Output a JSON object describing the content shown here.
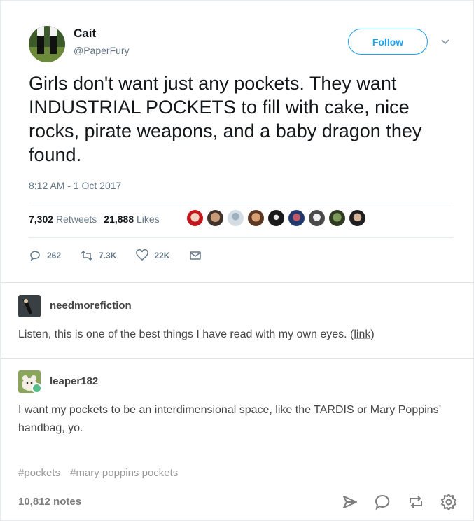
{
  "tweet": {
    "author_name": "Cait",
    "author_handle": "@PaperFury",
    "follow_label": "Follow",
    "text": "Girls don't want just any pockets. They want INDUSTRIAL POCKETS to fill with cake, nice rocks, pirate weapons, and a baby dragon they found.",
    "timestamp": "8:12 AM - 1 Oct 2017",
    "retweets_count": "7,302",
    "retweets_label": "Retweets",
    "likes_count": "21,888",
    "likes_label": "Likes",
    "reply_count": "262",
    "retweet_count_short": "7.3K",
    "like_count_short": "22K",
    "accent_color": "#1da1f2"
  },
  "reblogs": [
    {
      "username": "needmorefiction",
      "text": "Listen, this is one of the best things I have read with my own eyes. (",
      "link_text": "link",
      "text_end": ")"
    },
    {
      "username": "leaper182",
      "text": "I want my pockets to be an interdimensional space, like the TARDIS or Mary Poppins’ handbag, yo."
    }
  ],
  "tags": [
    "#pockets",
    "#mary poppins pockets"
  ],
  "notes": "10,812 notes",
  "icons": [
    "share-icon",
    "reply-icon",
    "reblog-icon",
    "settings-icon"
  ]
}
